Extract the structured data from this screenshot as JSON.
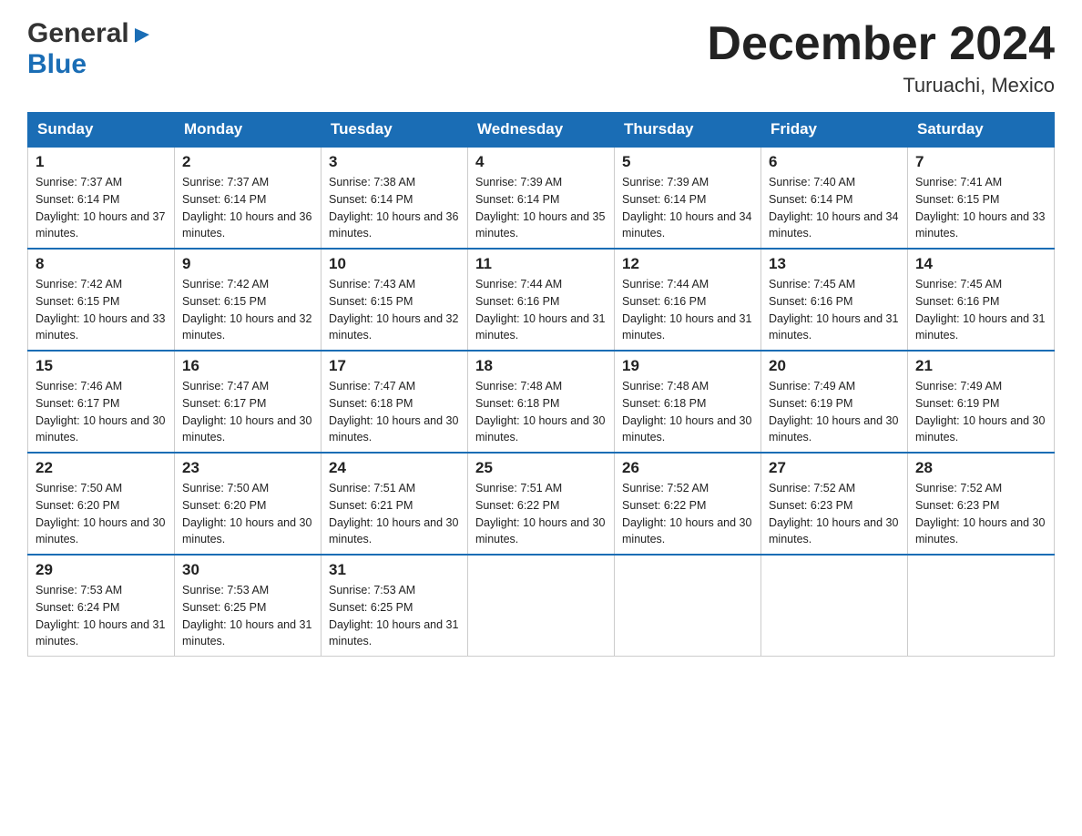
{
  "header": {
    "logo": {
      "line1": "General",
      "line2": "Blue",
      "triangle": "▶"
    },
    "title": "December 2024",
    "location": "Turuachi, Mexico"
  },
  "calendar": {
    "days_of_week": [
      "Sunday",
      "Monday",
      "Tuesday",
      "Wednesday",
      "Thursday",
      "Friday",
      "Saturday"
    ],
    "weeks": [
      [
        {
          "day": "1",
          "sunrise": "7:37 AM",
          "sunset": "6:14 PM",
          "daylight": "10 hours and 37 minutes."
        },
        {
          "day": "2",
          "sunrise": "7:37 AM",
          "sunset": "6:14 PM",
          "daylight": "10 hours and 36 minutes."
        },
        {
          "day": "3",
          "sunrise": "7:38 AM",
          "sunset": "6:14 PM",
          "daylight": "10 hours and 36 minutes."
        },
        {
          "day": "4",
          "sunrise": "7:39 AM",
          "sunset": "6:14 PM",
          "daylight": "10 hours and 35 minutes."
        },
        {
          "day": "5",
          "sunrise": "7:39 AM",
          "sunset": "6:14 PM",
          "daylight": "10 hours and 34 minutes."
        },
        {
          "day": "6",
          "sunrise": "7:40 AM",
          "sunset": "6:14 PM",
          "daylight": "10 hours and 34 minutes."
        },
        {
          "day": "7",
          "sunrise": "7:41 AM",
          "sunset": "6:15 PM",
          "daylight": "10 hours and 33 minutes."
        }
      ],
      [
        {
          "day": "8",
          "sunrise": "7:42 AM",
          "sunset": "6:15 PM",
          "daylight": "10 hours and 33 minutes."
        },
        {
          "day": "9",
          "sunrise": "7:42 AM",
          "sunset": "6:15 PM",
          "daylight": "10 hours and 32 minutes."
        },
        {
          "day": "10",
          "sunrise": "7:43 AM",
          "sunset": "6:15 PM",
          "daylight": "10 hours and 32 minutes."
        },
        {
          "day": "11",
          "sunrise": "7:44 AM",
          "sunset": "6:16 PM",
          "daylight": "10 hours and 31 minutes."
        },
        {
          "day": "12",
          "sunrise": "7:44 AM",
          "sunset": "6:16 PM",
          "daylight": "10 hours and 31 minutes."
        },
        {
          "day": "13",
          "sunrise": "7:45 AM",
          "sunset": "6:16 PM",
          "daylight": "10 hours and 31 minutes."
        },
        {
          "day": "14",
          "sunrise": "7:45 AM",
          "sunset": "6:16 PM",
          "daylight": "10 hours and 31 minutes."
        }
      ],
      [
        {
          "day": "15",
          "sunrise": "7:46 AM",
          "sunset": "6:17 PM",
          "daylight": "10 hours and 30 minutes."
        },
        {
          "day": "16",
          "sunrise": "7:47 AM",
          "sunset": "6:17 PM",
          "daylight": "10 hours and 30 minutes."
        },
        {
          "day": "17",
          "sunrise": "7:47 AM",
          "sunset": "6:18 PM",
          "daylight": "10 hours and 30 minutes."
        },
        {
          "day": "18",
          "sunrise": "7:48 AM",
          "sunset": "6:18 PM",
          "daylight": "10 hours and 30 minutes."
        },
        {
          "day": "19",
          "sunrise": "7:48 AM",
          "sunset": "6:18 PM",
          "daylight": "10 hours and 30 minutes."
        },
        {
          "day": "20",
          "sunrise": "7:49 AM",
          "sunset": "6:19 PM",
          "daylight": "10 hours and 30 minutes."
        },
        {
          "day": "21",
          "sunrise": "7:49 AM",
          "sunset": "6:19 PM",
          "daylight": "10 hours and 30 minutes."
        }
      ],
      [
        {
          "day": "22",
          "sunrise": "7:50 AM",
          "sunset": "6:20 PM",
          "daylight": "10 hours and 30 minutes."
        },
        {
          "day": "23",
          "sunrise": "7:50 AM",
          "sunset": "6:20 PM",
          "daylight": "10 hours and 30 minutes."
        },
        {
          "day": "24",
          "sunrise": "7:51 AM",
          "sunset": "6:21 PM",
          "daylight": "10 hours and 30 minutes."
        },
        {
          "day": "25",
          "sunrise": "7:51 AM",
          "sunset": "6:22 PM",
          "daylight": "10 hours and 30 minutes."
        },
        {
          "day": "26",
          "sunrise": "7:52 AM",
          "sunset": "6:22 PM",
          "daylight": "10 hours and 30 minutes."
        },
        {
          "day": "27",
          "sunrise": "7:52 AM",
          "sunset": "6:23 PM",
          "daylight": "10 hours and 30 minutes."
        },
        {
          "day": "28",
          "sunrise": "7:52 AM",
          "sunset": "6:23 PM",
          "daylight": "10 hours and 30 minutes."
        }
      ],
      [
        {
          "day": "29",
          "sunrise": "7:53 AM",
          "sunset": "6:24 PM",
          "daylight": "10 hours and 31 minutes."
        },
        {
          "day": "30",
          "sunrise": "7:53 AM",
          "sunset": "6:25 PM",
          "daylight": "10 hours and 31 minutes."
        },
        {
          "day": "31",
          "sunrise": "7:53 AM",
          "sunset": "6:25 PM",
          "daylight": "10 hours and 31 minutes."
        },
        null,
        null,
        null,
        null
      ]
    ]
  }
}
